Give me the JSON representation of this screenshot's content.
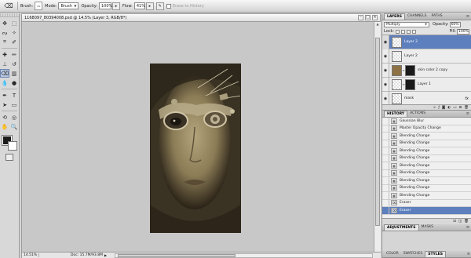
{
  "options_bar": {
    "brush_label": "Brush:",
    "brush_size": "21",
    "mode_label": "Mode:",
    "mode_value": "Brush",
    "opacity_label": "Opacity:",
    "opacity_value": "100%",
    "flow_label": "Flow:",
    "flow_value": "41%",
    "erase_history_label": "Erase to History"
  },
  "document": {
    "title": "1168097_80394008.psd @ 14.5% (Layer 3, RGB/8*)",
    "zoom": "14.51%",
    "doc_size": "Doc: 15.7M/93.8M"
  },
  "layers_panel": {
    "tabs": [
      "LAYERS",
      "CHANNELS",
      "PATHS"
    ],
    "blend_mode": "Multiply",
    "opacity_label": "Opacity:",
    "opacity_value": "60%",
    "lock_label": "Lock:",
    "fill_label": "Fill:",
    "fill_value": "100%",
    "layers": [
      {
        "name": "Layer 3",
        "selected": true
      },
      {
        "name": "Layer 2",
        "selected": false
      },
      {
        "name": "skin color 2 copy",
        "selected": false
      },
      {
        "name": "Layer 1",
        "selected": false
      },
      {
        "name": "mask",
        "selected": false,
        "fx": "fx"
      }
    ],
    "footer_icons": [
      "link-icon",
      "fx-icon",
      "mask-icon",
      "adjustment-icon",
      "folder-icon",
      "new-layer-icon",
      "trash-icon"
    ]
  },
  "history_panel": {
    "tabs": [
      "HISTORY",
      "ACTIONS"
    ],
    "items": [
      {
        "label": "Gaussian Blur",
        "selected": false
      },
      {
        "label": "Master Opacity Change",
        "selected": false
      },
      {
        "label": "Blending Change",
        "selected": false
      },
      {
        "label": "Blending Change",
        "selected": false
      },
      {
        "label": "Blending Change",
        "selected": false
      },
      {
        "label": "Blending Change",
        "selected": false
      },
      {
        "label": "Blending Change",
        "selected": false
      },
      {
        "label": "Blending Change",
        "selected": false
      },
      {
        "label": "Blending Change",
        "selected": false
      },
      {
        "label": "Blending Change",
        "selected": false
      },
      {
        "label": "Blending Change",
        "selected": false
      },
      {
        "label": "Eraser",
        "selected": false
      },
      {
        "label": "Eraser",
        "selected": true
      }
    ]
  },
  "adjustments_panel": {
    "tabs": [
      "ADJUSTMENTS",
      "MASKS"
    ]
  },
  "color_panel": {
    "tabs": [
      "COLOR",
      "SWATCHES",
      "STYLES"
    ]
  }
}
